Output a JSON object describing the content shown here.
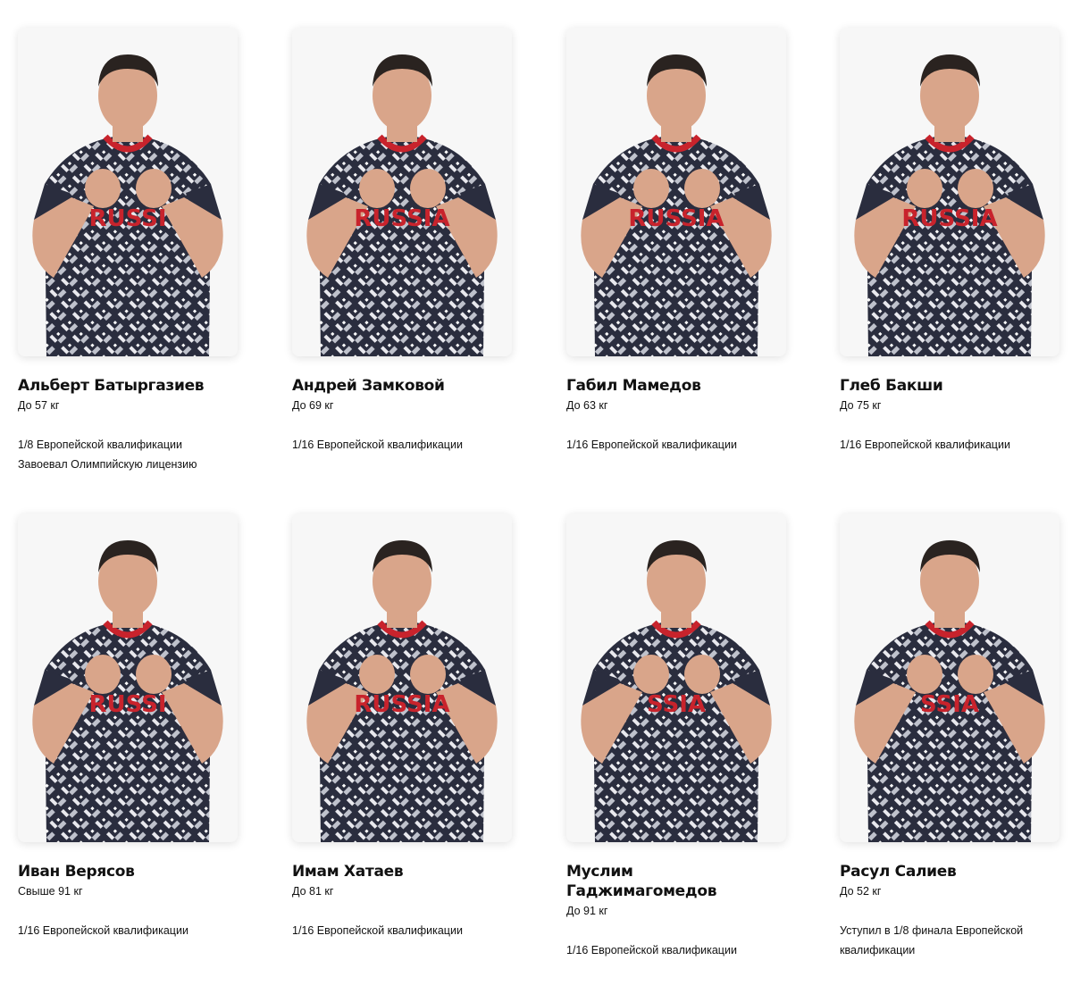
{
  "boxers": [
    {
      "name": "Альберт Батыргазиев",
      "weight": "До 57 кг",
      "results": [
        "1/8 Европейской квалификации",
        "Завоевал Олимпийскую лицензию"
      ],
      "shirt_text": "RUSSI",
      "portrait_icon": "boxer-photo-icon"
    },
    {
      "name": "Андрей Замковой",
      "weight": "До 69 кг",
      "results": [
        "1/16 Европейской квалификации"
      ],
      "shirt_text": "RUSSIA",
      "portrait_icon": "boxer-photo-icon"
    },
    {
      "name": "Габил Мамедов",
      "weight": "До 63 кг",
      "results": [
        "1/16 Европейской квалификации"
      ],
      "shirt_text": "RUSSIA",
      "portrait_icon": "boxer-photo-icon"
    },
    {
      "name": "Глеб Бакши",
      "weight": "До 75 кг",
      "results": [
        "1/16 Европейской квалификации"
      ],
      "shirt_text": "RUSSIA",
      "portrait_icon": "boxer-photo-icon"
    },
    {
      "name": "Иван Верясов",
      "weight": "Свыше 91 кг",
      "results": [
        "1/16 Европейской квалификации"
      ],
      "shirt_text": "RUSSI",
      "portrait_icon": "boxer-photo-icon"
    },
    {
      "name": "Имам Хатаев",
      "weight": "До 81 кг",
      "results": [
        "1/16 Европейской квалификации"
      ],
      "shirt_text": "RUSSIA",
      "portrait_icon": "boxer-photo-icon"
    },
    {
      "name": "Муслим Гаджимагомедов",
      "weight": "До 91 кг",
      "results": [
        "1/16 Европейской квалификации"
      ],
      "shirt_text": "SSIA",
      "portrait_icon": "boxer-photo-icon"
    },
    {
      "name": "Расул Салиев",
      "weight": "До 52 кг",
      "results": [
        "Уступил в 1/8 финала Европейской квалификации"
      ],
      "shirt_text": "SSIA",
      "portrait_icon": "boxer-photo-icon"
    }
  ],
  "colors": {
    "shirt": "#2a2d3e",
    "accent": "#c8232c",
    "skin": "#d9a58a",
    "hair": "#2a2320",
    "background": "#f7f7f7"
  }
}
